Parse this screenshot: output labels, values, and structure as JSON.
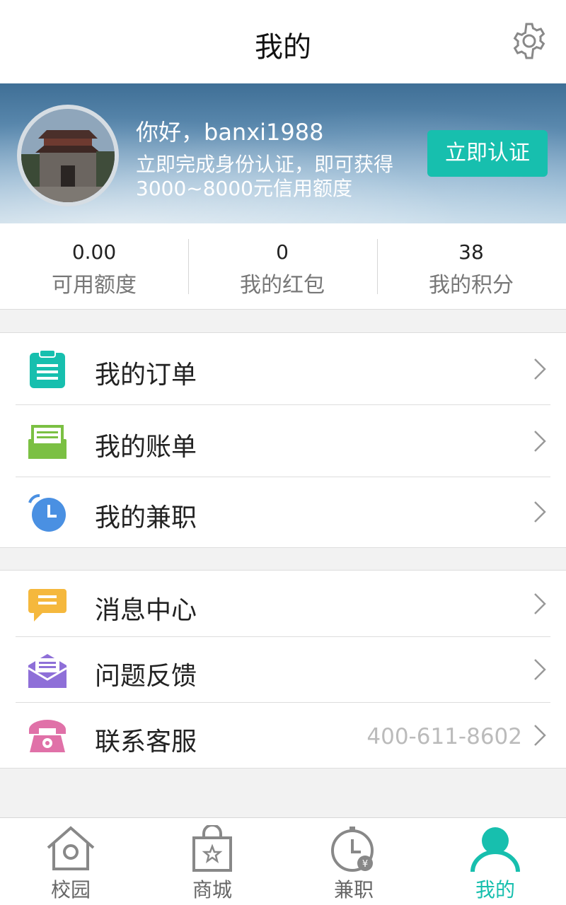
{
  "header": {
    "title": "我的",
    "settings_icon": "gear-icon"
  },
  "profile": {
    "greeting": "你好，banxi1988",
    "promo": "立即完成身份认证，即可获得3000~8000元信用额度",
    "verify_label": "立即认证"
  },
  "stats": [
    {
      "value": "0.00",
      "label": "可用额度"
    },
    {
      "value": "0",
      "label": "我的红包"
    },
    {
      "value": "38",
      "label": "我的积分"
    }
  ],
  "menu_group_1": [
    {
      "label": "我的订单",
      "icon": "clipboard-icon"
    },
    {
      "label": "我的账单",
      "icon": "bill-tray-icon"
    },
    {
      "label": "我的兼职",
      "icon": "alarm-clock-icon"
    }
  ],
  "menu_group_2": [
    {
      "label": "消息中心",
      "icon": "chat-bubble-icon"
    },
    {
      "label": "问题反馈",
      "icon": "mail-feedback-icon"
    },
    {
      "label": "联系客服",
      "icon": "telephone-icon",
      "extra": "400-611-8602"
    }
  ],
  "tabs": [
    {
      "label": "校园",
      "icon": "home-icon"
    },
    {
      "label": "商城",
      "icon": "shopping-bag-icon"
    },
    {
      "label": "兼职",
      "icon": "clock-yen-icon"
    },
    {
      "label": "我的",
      "icon": "person-icon",
      "active": true
    }
  ],
  "colors": {
    "accent": "#17bfae",
    "order_icon": "#17bfae",
    "bill_icon": "#7bc043",
    "job_icon": "#4a90e2",
    "msg_icon": "#f5b83d",
    "feedback_icon": "#8e6fd8",
    "phone_icon": "#e071a8"
  }
}
